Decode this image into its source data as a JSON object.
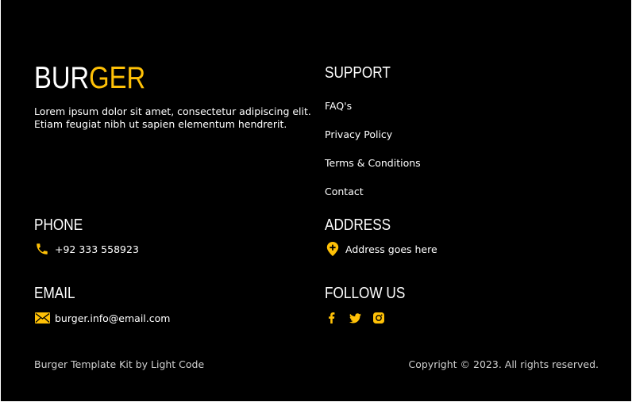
{
  "brand": {
    "logo_part1": "BUR",
    "logo_part2": "GER",
    "accent": "#ffc107"
  },
  "about": {
    "text": "Lorem ipsum dolor sit amet, consectetur adipiscing elit. Etiam feugiat nibh ut sapien elementum hendrerit."
  },
  "support": {
    "heading": "SUPPORT",
    "links": [
      "FAQ's",
      "Privacy Policy",
      "Terms & Conditions",
      "Contact"
    ]
  },
  "phone": {
    "heading": "PHONE",
    "value": "+92 333 558923",
    "icon": "phone-icon"
  },
  "address": {
    "heading": "ADDRESS",
    "value": "Address goes here",
    "icon": "map-pin-icon"
  },
  "email": {
    "heading": "EMAIL",
    "value": "burger.info@email.com",
    "icon": "envelope-icon"
  },
  "follow": {
    "heading": "FOLLOW US",
    "icons": [
      "facebook-icon",
      "twitter-icon",
      "instagram-icon"
    ]
  },
  "bottom": {
    "credit": "Burger Template Kit by Light Code",
    "copyright": "Copyright © 2023. All rights reserved."
  }
}
